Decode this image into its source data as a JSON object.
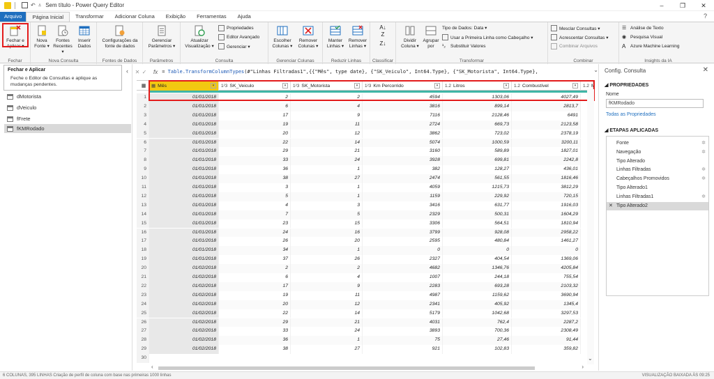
{
  "window": {
    "title": "Sem título - Power Query Editor",
    "controls": [
      "–",
      "❐",
      "✕"
    ]
  },
  "menu": {
    "tabs": [
      "Arquivo",
      "Página Inicial",
      "Transformar",
      "Adicionar Coluna",
      "Exibição",
      "Ferramentas",
      "Ajuda"
    ],
    "help_icon": "?"
  },
  "ribbon": {
    "groups": {
      "fechar": "Fechar",
      "nova_consulta": "Nova Consulta",
      "fontes_dados": "Fontes de Dados",
      "parametros": "Parâmetros",
      "consulta": "Consulta",
      "gerenciar_colunas": "Gerenciar Colunas",
      "reduzir_linhas": "Reduzir Linhas",
      "classificar": "Classificar",
      "transformar": "Transformar",
      "combinar": "Combinar",
      "insights": "Insights da IA"
    },
    "buttons": {
      "fechar_aplicar": "Fechar e\nAplicar ▾",
      "nova_fonte": "Nova\nFonte ▾",
      "fontes_recentes": "Fontes\nRecentes ▾",
      "inserir_dados": "Inserir\nDados",
      "config_fonte": "Configurações da\nfonte de dados",
      "gerenciar_parametros": "Gerenciar\nParâmetros ▾",
      "atualizar_visualizacao": "Atualizar\nVisualização ▾",
      "propriedades": "Propriedades",
      "editor_avancado": "Editor Avançado",
      "gerenciar": "Gerenciar ▾",
      "escolher_colunas": "Escolher\nColunas ▾",
      "remover_colunas": "Remover\nColunas ▾",
      "manter_linhas": "Manter\nLinhas ▾",
      "remover_linhas": "Remover\nLinhas ▾",
      "dividir_coluna": "Dividir\nColuna ▾",
      "agrupar_por": "Agrupar\npor",
      "tipo_dados": "Tipo de Dados: Data ▾",
      "primeira_linha": "Usar a Primeira Linha como Cabeçalho ▾",
      "substituir_valores": "Substituir Valores",
      "mesclar": "Mesclar Consultas ▾",
      "acrescentar": "Acrescentar Consultas ▾",
      "combinar_arquivos": "Combinar Arquivos",
      "analise_texto": "Análise de Texto",
      "pesquisa_visual": "Pesquisa Visual",
      "azure_ml": "Azure Machine Learning"
    }
  },
  "tooltip": {
    "title": "Fechar e Aplicar",
    "body": "Feche o Editor de Consultas e aplique as mudanças pendentes."
  },
  "queries": {
    "collapse_icon": "‹",
    "items": [
      "dMotorista",
      "dVeiculo",
      "fFrete",
      "fKMRodado"
    ],
    "selected": "fKMRodado"
  },
  "formula": {
    "fx": "fx",
    "prefix": "= ",
    "func": "Table.TransformColumnTypes",
    "text": "(#\"Linhas Filtradas1\",{{\"Mês\", type date}, {\"SK_Veiculo\", Int64.Type}, {\"SK_Motorista\", Int64.Type},"
  },
  "grid": {
    "columns": [
      {
        "type": "▦",
        "name": "Mês"
      },
      {
        "type": "1²3",
        "name": "SK_Veiculo"
      },
      {
        "type": "1²3",
        "name": "SK_Motorista"
      },
      {
        "type": "1²3",
        "name": "Km Percorrido"
      },
      {
        "type": "1.2",
        "name": "Litros"
      },
      {
        "type": "1.2",
        "name": "Combustível"
      },
      {
        "type": "1.2",
        "name": "Ma"
      }
    ],
    "rows": [
      [
        "01/01/2018",
        "2",
        "2",
        "4594",
        "1303,06",
        "4027,49"
      ],
      [
        "01/01/2018",
        "6",
        "4",
        "3816",
        "899,14",
        "2813,7"
      ],
      [
        "01/01/2018",
        "17",
        "9",
        "7116",
        "2128,46",
        "6491"
      ],
      [
        "01/01/2018",
        "19",
        "11",
        "2724",
        "669,73",
        "2123,58"
      ],
      [
        "01/01/2018",
        "20",
        "12",
        "3862",
        "723,02",
        "2378,19"
      ],
      [
        "01/01/2018",
        "22",
        "14",
        "5074",
        "1000,59",
        "3200,11"
      ],
      [
        "01/01/2018",
        "29",
        "21",
        "3160",
        "589,89",
        "1827,01"
      ],
      [
        "01/01/2018",
        "33",
        "24",
        "3928",
        "699,81",
        "2242,8"
      ],
      [
        "01/01/2018",
        "36",
        "1",
        "382",
        "128,27",
        "436,01"
      ],
      [
        "01/01/2018",
        "38",
        "27",
        "2474",
        "561,55",
        "1816,46"
      ],
      [
        "01/01/2018",
        "3",
        "1",
        "4059",
        "1215,73",
        "3812,29"
      ],
      [
        "01/01/2018",
        "5",
        "1",
        "1159",
        "229,92",
        "720,15"
      ],
      [
        "01/01/2018",
        "4",
        "3",
        "3416",
        "631,77",
        "1916,03"
      ],
      [
        "01/01/2018",
        "7",
        "5",
        "2329",
        "500,31",
        "1604,29"
      ],
      [
        "01/01/2018",
        "23",
        "15",
        "3306",
        "564,51",
        "1810,94"
      ],
      [
        "01/01/2018",
        "24",
        "16",
        "3799",
        "928,08",
        "2958,22"
      ],
      [
        "01/01/2018",
        "26",
        "20",
        "2595",
        "480,84",
        "1461,27"
      ],
      [
        "01/01/2018",
        "34",
        "1",
        "0",
        "0",
        "0"
      ],
      [
        "01/01/2018",
        "37",
        "26",
        "2327",
        "404,54",
        "1369,06"
      ],
      [
        "01/02/2018",
        "2",
        "2",
        "4682",
        "1346,76",
        "4205,84"
      ],
      [
        "01/02/2018",
        "6",
        "4",
        "1007",
        "244,18",
        "755,54"
      ],
      [
        "01/02/2018",
        "17",
        "9",
        "2283",
        "693,28",
        "2103,32"
      ],
      [
        "01/02/2018",
        "19",
        "11",
        "4987",
        "1159,62",
        "3690,94"
      ],
      [
        "01/02/2018",
        "20",
        "12",
        "2341",
        "405,92",
        "1345,4"
      ],
      [
        "01/02/2018",
        "22",
        "14",
        "5179",
        "1042,68",
        "3297,53"
      ],
      [
        "01/02/2018",
        "29",
        "21",
        "4031",
        "762,4",
        "2287,2"
      ],
      [
        "01/02/2018",
        "33",
        "24",
        "3893",
        "700,36",
        "2308,49"
      ],
      [
        "01/02/2018",
        "36",
        "1",
        "75",
        "27,46",
        "91,44"
      ],
      [
        "01/02/2018",
        "38",
        "27",
        "921",
        "102,83",
        "359,82"
      ]
    ],
    "last_row_number": "30"
  },
  "settings": {
    "title": "Config. Consulta",
    "properties_heading": "PROPRIEDADES",
    "name_label": "Nome",
    "name_value": "fKMRodado",
    "all_properties_link": "Todas as Propriedades",
    "steps_heading": "ETAPAS APLICADAS",
    "steps": [
      {
        "label": "Fonte",
        "gear": true
      },
      {
        "label": "Navegação",
        "gear": true
      },
      {
        "label": "Tipo Alterado",
        "gear": false
      },
      {
        "label": "Linhas Filtradas",
        "gear": true
      },
      {
        "label": "Cabeçalhos Promovidos",
        "gear": true
      },
      {
        "label": "Tipo Alterado1",
        "gear": false
      },
      {
        "label": "Linhas Filtradas1",
        "gear": true
      },
      {
        "label": "Tipo Alterado2",
        "gear": false,
        "selected": true
      }
    ]
  },
  "status": {
    "left": "6 COLUNAS, 395 LINHAS    Criação de perfil de coluna com base nas primeiras 1000 linhas",
    "right": "VISUALIZAÇÃO BAIXADA ÀS 09:25"
  }
}
